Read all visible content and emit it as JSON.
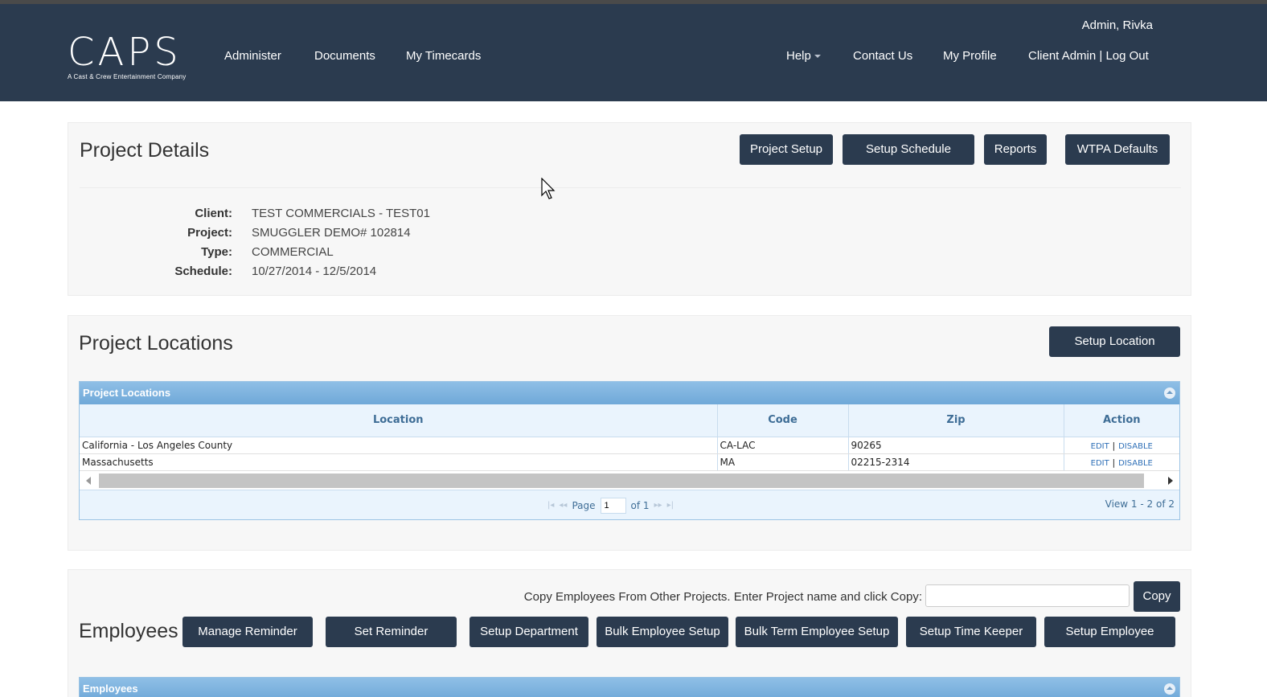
{
  "header": {
    "logo_text": "CAPS",
    "logo_tagline": "A Cast & Crew Entertainment Company",
    "nav_left": [
      "Administer",
      "Documents",
      "My Timecards"
    ],
    "user": "Admin, Rivka",
    "help": "Help",
    "contact": "Contact Us",
    "profile": "My Profile",
    "client_logout": "Client Admin | Log Out"
  },
  "project_details": {
    "title": "Project Details",
    "buttons": [
      "Project Setup",
      "Setup Schedule",
      "Reports",
      "WTPA Defaults"
    ],
    "fields": [
      {
        "label": "Client:",
        "value": "TEST COMMERCIALS - TEST01"
      },
      {
        "label": "Project:",
        "value": "SMUGGLER DEMO# 102814"
      },
      {
        "label": "Type:",
        "value": "COMMERCIAL"
      },
      {
        "label": "Schedule:",
        "value": "10/27/2014 - 12/5/2014"
      }
    ]
  },
  "project_locations": {
    "title": "Project Locations",
    "setup_button": "Setup Location",
    "grid_caption": "Project Locations",
    "columns": [
      "Location",
      "Code",
      "Zip",
      "Action"
    ],
    "rows": [
      {
        "location": "California - Los Angeles County",
        "code": "CA-LAC",
        "zip": "90265",
        "edit": "EDIT",
        "sep": "|",
        "disable": "DISABLE"
      },
      {
        "location": "Massachusetts",
        "code": "MA",
        "zip": "02215-2314",
        "edit": "EDIT",
        "sep": "|",
        "disable": "DISABLE"
      }
    ],
    "pager": {
      "page_label": "Page",
      "page_value": "1",
      "of_label": "of 1",
      "view_text": "View 1 - 2 of 2"
    }
  },
  "employees": {
    "title": "Employees",
    "copy_text": "Copy Employees From Other Projects. Enter Project name and click Copy:",
    "copy_input_value": "",
    "copy_button": "Copy",
    "buttons": [
      "Manage Reminder",
      "Set Reminder",
      "Setup Department",
      "Bulk Employee Setup",
      "Bulk Term Employee Setup",
      "Setup Time Keeper",
      "Setup Employee"
    ],
    "grid_caption": "Employees"
  },
  "colors": {
    "header_bg": "#2b3b4f",
    "button_bg": "#2b3b4f",
    "grid_caption": "#7fb3df",
    "link": "#2e6fb7"
  }
}
